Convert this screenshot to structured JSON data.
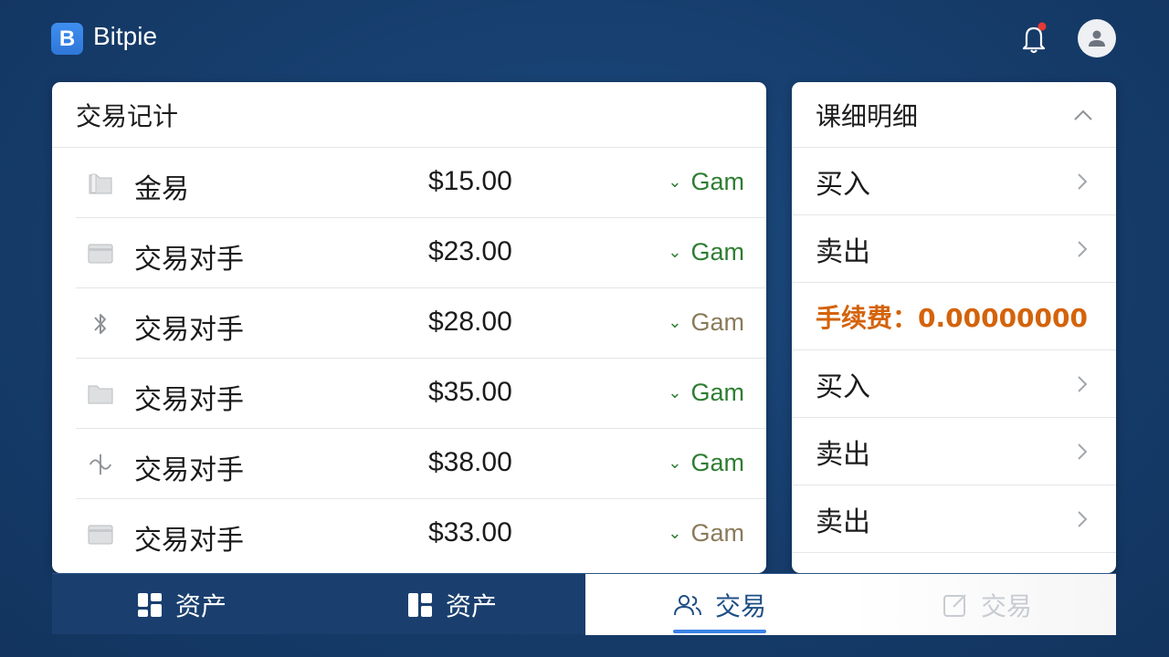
{
  "app": {
    "title": "Bitpie",
    "logo_letter": "B"
  },
  "header": {
    "bell_icon": "bell-icon",
    "notification_dot_color": "#e53935",
    "avatar_icon": "user-avatar-icon"
  },
  "transactions": {
    "title": "交易记计",
    "rows": [
      {
        "icon": "folder-icon",
        "name": "金易",
        "amount": "$15.00",
        "status": "Gam",
        "status_color": "#2e7d32"
      },
      {
        "icon": "card-icon",
        "name": "交易对手",
        "amount": "$23.00",
        "status": "Gam",
        "status_color": "#2e7d32"
      },
      {
        "icon": "bluetooth-icon",
        "name": "交易对手",
        "amount": "$28.00",
        "status": "Gam",
        "status_color": "#8a7a5a"
      },
      {
        "icon": "folder-icon",
        "name": "交易对手",
        "amount": "$35.00",
        "status": "Gam",
        "status_color": "#2e7d32"
      },
      {
        "icon": "antenna-icon",
        "name": "交易对手",
        "amount": "$38.00",
        "status": "Gam",
        "status_color": "#2e7d32"
      },
      {
        "icon": "card-icon",
        "name": "交易对手",
        "amount": "$33.00",
        "status": "Gam",
        "status_color": "#8a7a5a"
      }
    ]
  },
  "details": {
    "title": "课细明细",
    "rows": [
      {
        "label": "买入"
      },
      {
        "label": "卖出"
      },
      {
        "label": "手续费：0.00000000",
        "highlight": true
      },
      {
        "label": "买入"
      },
      {
        "label": "卖出"
      },
      {
        "label": "卖出"
      }
    ]
  },
  "bottom_nav": [
    {
      "label": "资产",
      "icon": "dashboard-icon"
    },
    {
      "label": "资产",
      "icon": "layout-icon"
    },
    {
      "label": "交易",
      "icon": "users-icon",
      "active": true
    },
    {
      "label": "交易",
      "icon": "edit-icon"
    }
  ]
}
